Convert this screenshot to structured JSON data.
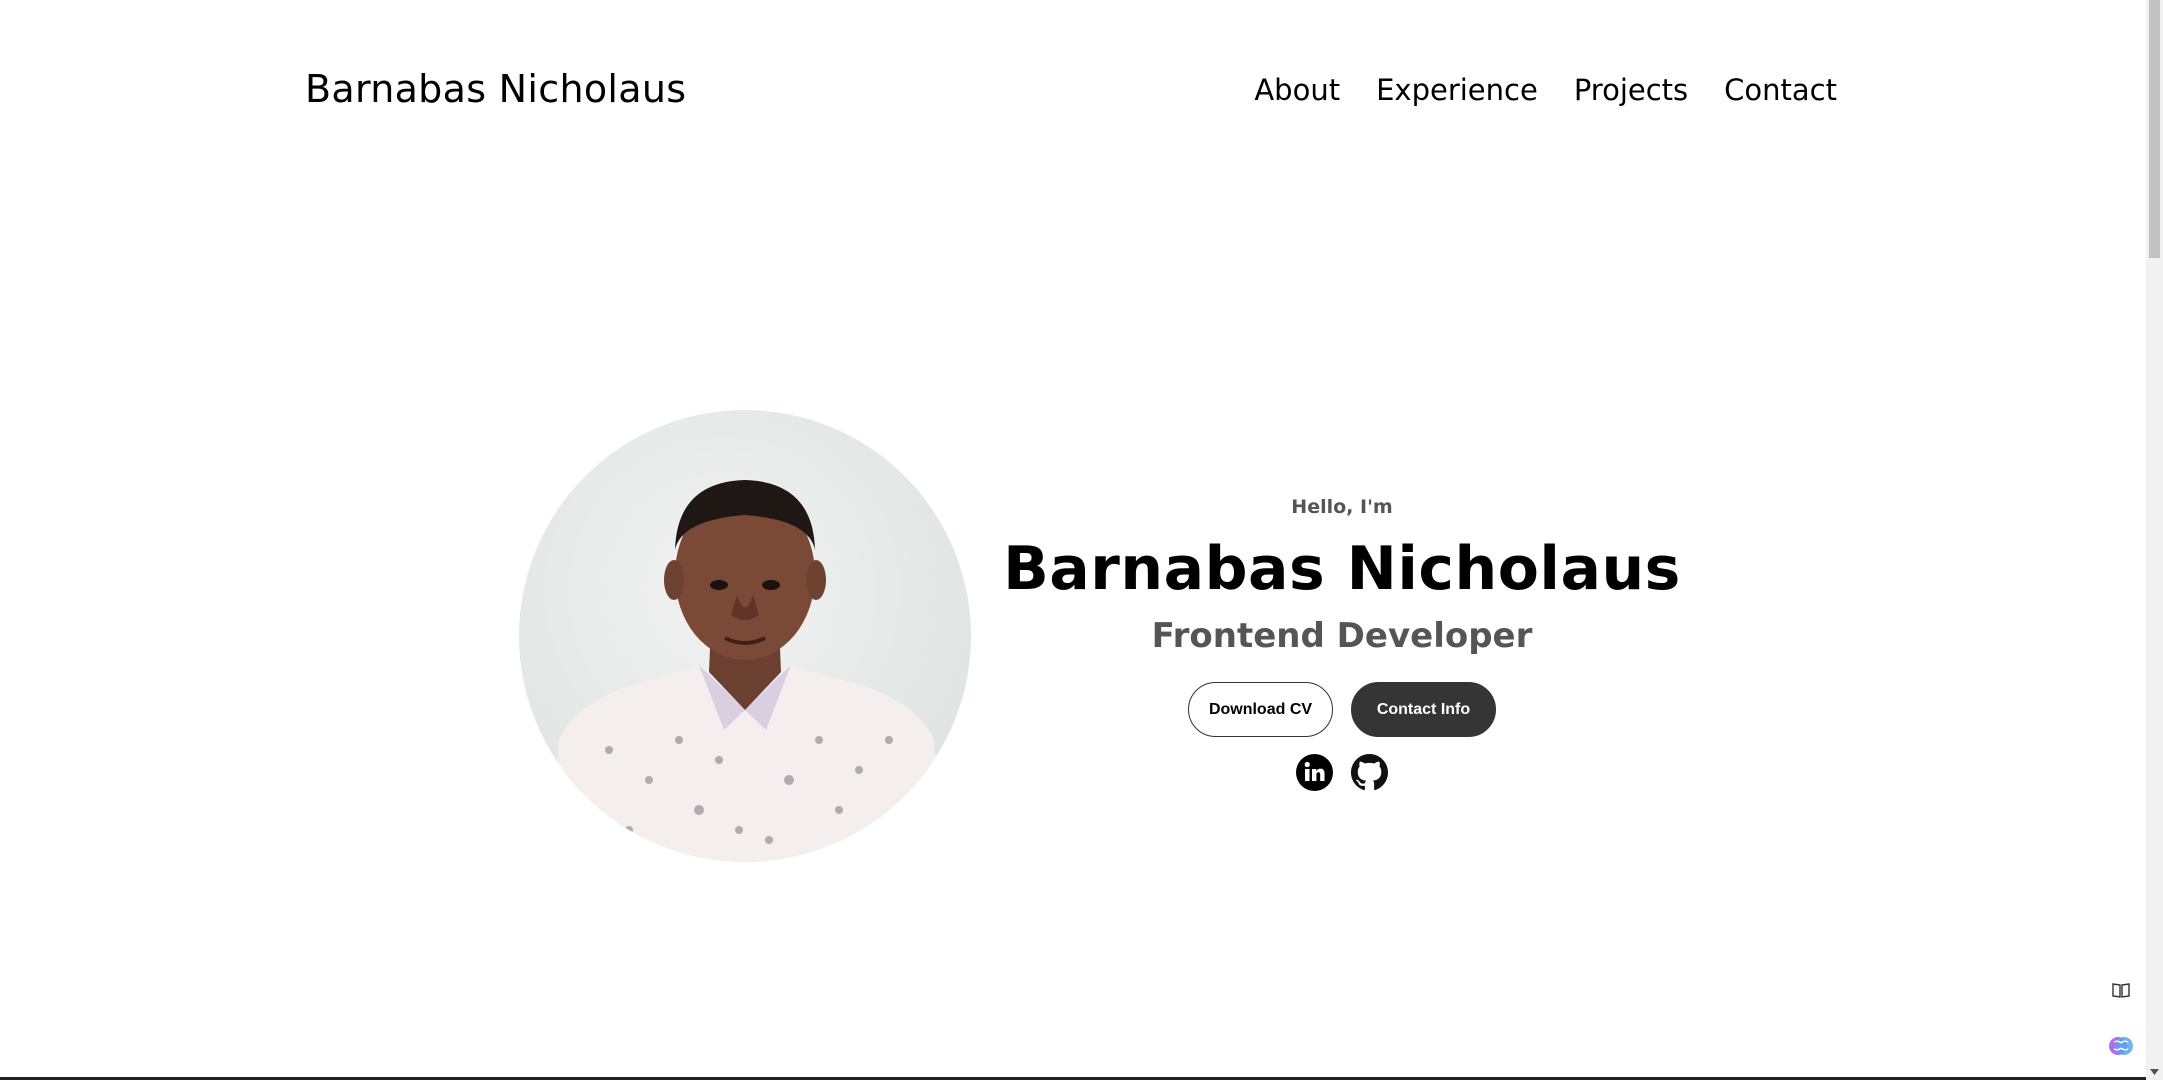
{
  "header": {
    "logo_text": "Barnabas Nicholaus",
    "nav": [
      {
        "label": "About"
      },
      {
        "label": "Experience"
      },
      {
        "label": "Projects"
      },
      {
        "label": "Contact"
      }
    ]
  },
  "hero": {
    "greeting": "Hello, I'm",
    "name": "Barnabas Nicholaus",
    "role": "Frontend Developer",
    "buttons": {
      "download_cv": "Download CV",
      "contact_info": "Contact Info"
    },
    "socials": [
      {
        "icon": "linkedin-icon"
      },
      {
        "icon": "github-icon"
      }
    ],
    "profile_image": "profile-photo"
  },
  "colors": {
    "text": "#000000",
    "muted_text": "#555555",
    "solid_button": "#353535",
    "background": "#ffffff"
  }
}
